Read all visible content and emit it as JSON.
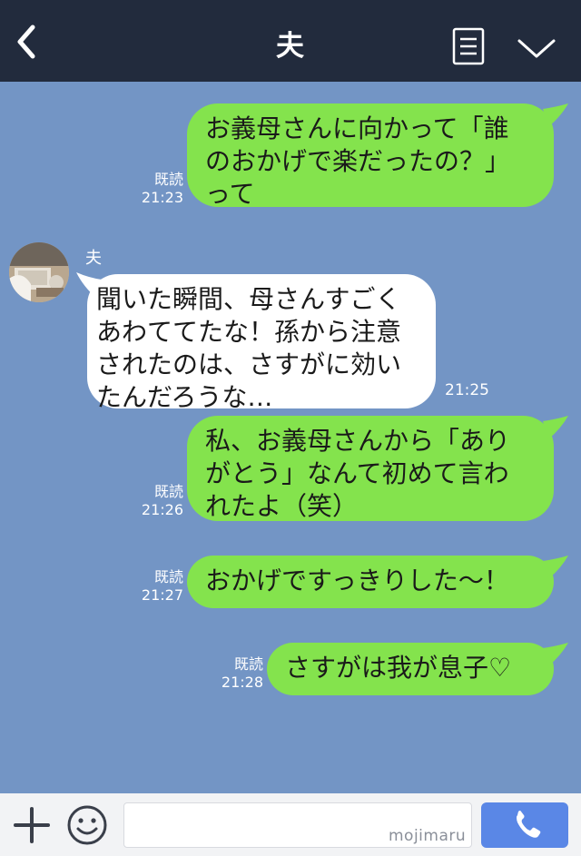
{
  "header": {
    "title": "夫"
  },
  "chat": {
    "sender_name": "夫",
    "messages": [
      {
        "side": "right",
        "text_lines": [
          "お義母さんに向かって「誰",
          "のおかげで楽だったの？」",
          "って"
        ],
        "read": "既読",
        "time": "21:23"
      },
      {
        "side": "left",
        "text_lines": [
          "聞いた瞬間、母さんすごく",
          "あわててたな！孫から注意",
          "されたのは、さすがに効い",
          "たんだろうな…"
        ],
        "time": "21:25"
      },
      {
        "side": "right",
        "text_lines": [
          "私、お義母さんから「あり",
          "がとう」なんて初めて言わ",
          "れたよ（笑）"
        ],
        "read": "既読",
        "time": "21:26"
      },
      {
        "side": "right",
        "text_lines": [
          "おかげですっきりした〜！"
        ],
        "read": "既読",
        "time": "21:27"
      },
      {
        "side": "right",
        "text_lines": [
          "さすがは我が息子♡"
        ],
        "read": "既読",
        "time": "21:28"
      }
    ]
  },
  "input": {
    "watermark": "mojimaru"
  },
  "icons": {
    "back": "chevron-left-icon",
    "menu": "note-list-icon",
    "collapse": "chevron-down-icon",
    "plus": "plus-icon",
    "emoji": "smiley-icon",
    "call": "phone-icon"
  },
  "colors": {
    "header_bg": "#222b3d",
    "chat_bg": "#7395c5",
    "my_bubble": "#84e34d",
    "their_bubble": "#ffffff",
    "call_button": "#5a87e6"
  }
}
